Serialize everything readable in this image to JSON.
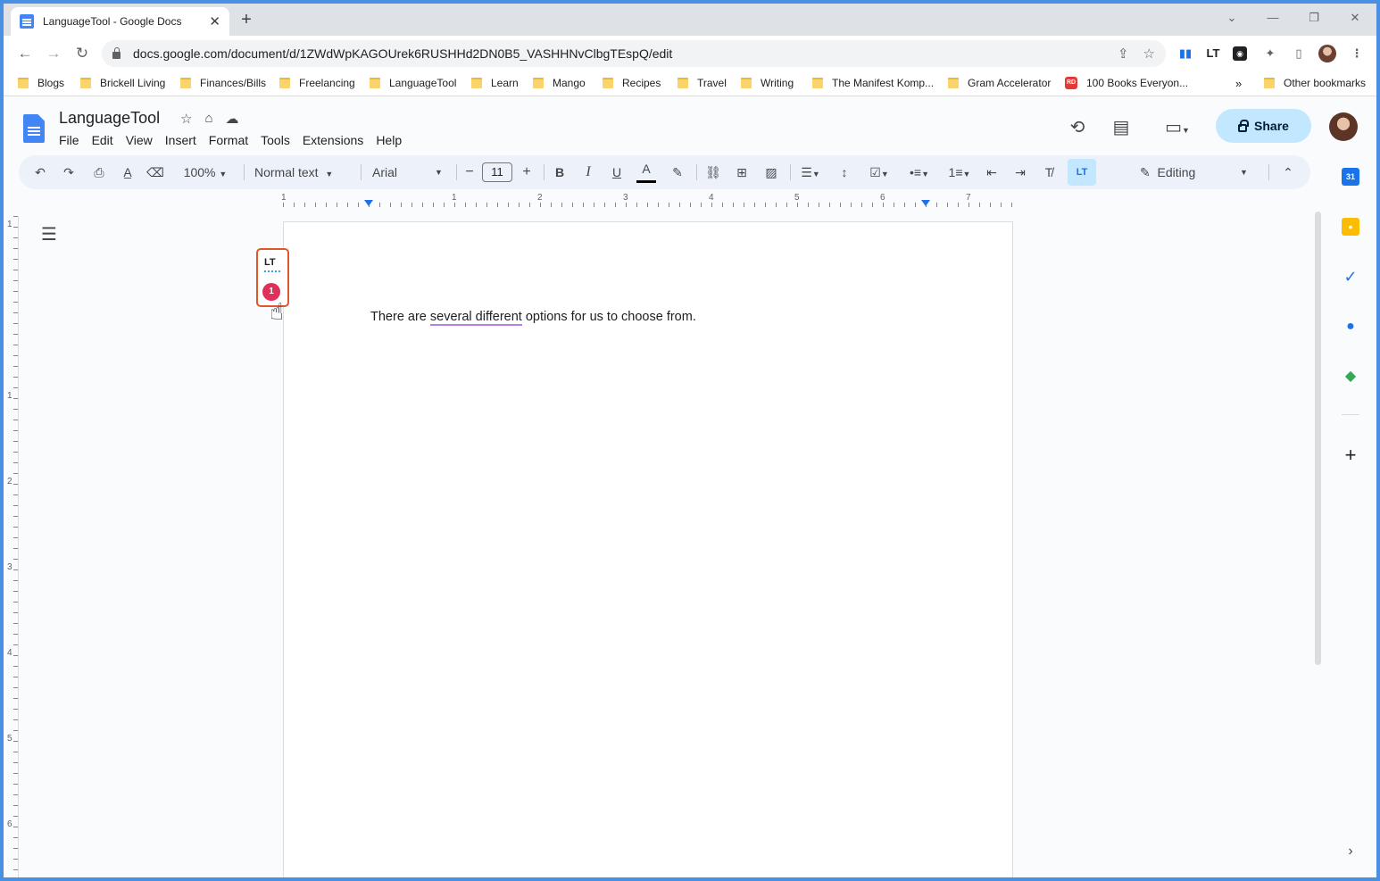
{
  "browser": {
    "tab_title": "LanguageTool - Google Docs",
    "tab_close": "✕",
    "new_tab": "+",
    "url": "docs.google.com/document/d/1ZWdWpKAGOUrek6RUSHHd2DN0B5_VASHHNvClbgTEspQ/edit",
    "extension_lt": "LT"
  },
  "bookmarks": [
    {
      "label": "Blogs",
      "type": "folder"
    },
    {
      "label": "Brickell Living",
      "type": "folder"
    },
    {
      "label": "Finances/Bills",
      "type": "folder"
    },
    {
      "label": "Freelancing",
      "type": "folder"
    },
    {
      "label": "LanguageTool",
      "type": "folder"
    },
    {
      "label": "Learn",
      "type": "folder"
    },
    {
      "label": "Mango",
      "type": "folder"
    },
    {
      "label": "Recipes",
      "type": "folder"
    },
    {
      "label": "Travel",
      "type": "folder"
    },
    {
      "label": "Writing",
      "type": "folder"
    },
    {
      "label": "The Manifest Komp...",
      "type": "folder"
    },
    {
      "label": "Gram Accelerator",
      "type": "folder"
    },
    {
      "label": "100 Books Everyon...",
      "type": "rd"
    }
  ],
  "bookmarks_overflow": "»",
  "other_bookmarks": "Other bookmarks",
  "docs": {
    "title": "LanguageTool",
    "menu": [
      "File",
      "Edit",
      "View",
      "Insert",
      "Format",
      "Tools",
      "Extensions",
      "Help"
    ],
    "share_label": "Share"
  },
  "toolbar": {
    "zoom": "100%",
    "style": "Normal text",
    "font": "Arial",
    "font_size": "11",
    "mode": "Editing",
    "lt": "LT"
  },
  "ruler": {
    "numbers": [
      "1",
      "1",
      "2",
      "3",
      "4",
      "5",
      "6",
      "7"
    ]
  },
  "vruler": {
    "numbers": [
      "1",
      "1",
      "2",
      "3",
      "4",
      "5",
      "6"
    ]
  },
  "document": {
    "text_before": "There are ",
    "text_flagged": "several different",
    "text_after": " options for us to choose from."
  },
  "lt_widget": {
    "logo": "LT",
    "issue_count": "1"
  },
  "colors": {
    "accent": "#1a73e8",
    "share_bg": "#c2e7ff",
    "lt_border": "#e0582a",
    "lt_badge": "#e0305a",
    "flag_underline": "#b87ee8"
  }
}
